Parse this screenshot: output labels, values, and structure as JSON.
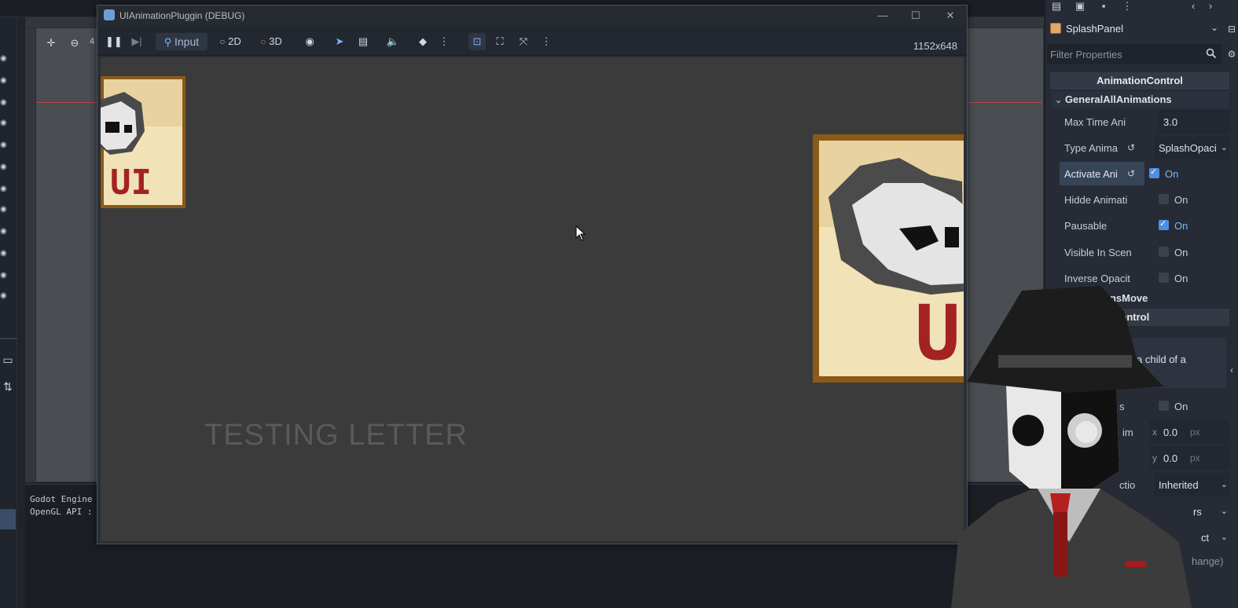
{
  "editor": {
    "viewport_zoom": "4",
    "output_lines": [
      "Godot Engine",
      "OpenGL API :"
    ]
  },
  "debug_window": {
    "title": "UIAnimationPluggin (DEBUG)",
    "toolbar": {
      "input_label": "Input",
      "mode_2d": "2D",
      "mode_3d": "3D",
      "resolution": "1152x648"
    },
    "game": {
      "testing_text": "TESTING LETTER",
      "card_left_text": "UI",
      "card_right_text": "U"
    }
  },
  "inspector": {
    "node_name": "SplashPanel",
    "filter_placeholder": "Filter Properties",
    "section_title": "AnimationControl",
    "group_title": "GeneralAllAnimations",
    "properties": [
      {
        "label": "Max Time Ani",
        "value": "3.0"
      },
      {
        "label": "Type Anima",
        "value": "SplashOpaci"
      },
      {
        "label": "Activate Ani",
        "value": "On",
        "checked": true
      },
      {
        "label": "Hidde Animati",
        "value": "On",
        "checked": false
      },
      {
        "label": "Pausable",
        "value": "On",
        "checked": true
      },
      {
        "label": "Visible In Scen",
        "value": "On",
        "checked": false
      },
      {
        "label": "Inverse Opacit",
        "value": "On",
        "checked": false
      }
    ],
    "group2_title": "onsMove",
    "group3_title": "Control",
    "note_text": "a child of a",
    "lower_rows": [
      {
        "label": "s",
        "value": "On"
      },
      {
        "label": "im",
        "axis": "x",
        "value": "0.0",
        "unit": "px"
      },
      {
        "label": "",
        "axis": "y",
        "value": "0.0",
        "unit": "px"
      },
      {
        "label": "ctio",
        "value": "Inherited"
      },
      {
        "label": "",
        "value": "rs"
      },
      {
        "label": "",
        "value": "ct"
      },
      {
        "label": "",
        "value": "hange)"
      }
    ]
  }
}
